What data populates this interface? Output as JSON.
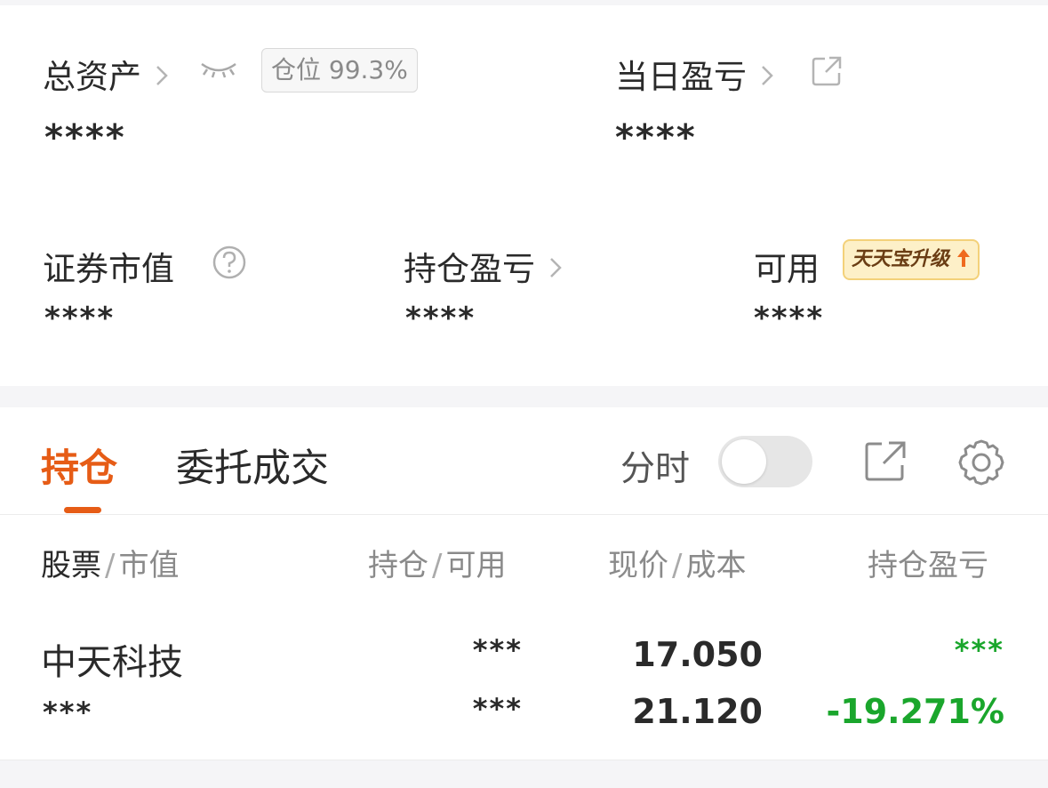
{
  "summary": {
    "total_assets_label": "总资产",
    "total_assets_value": "****",
    "position_ratio": "仓位 99.3%",
    "daily_pnl_label": "当日盈亏",
    "daily_pnl_value": "****",
    "securities_value_label": "证券市值",
    "securities_value_value": "****",
    "holding_pnl_label": "持仓盈亏",
    "holding_pnl_value": "****",
    "available_label": "可用",
    "available_value": "****",
    "upgrade_badge": "天天宝升级",
    "chevron": ">"
  },
  "tabs": [
    {
      "label": "持仓",
      "active": true
    },
    {
      "label": "委托成交",
      "active": false
    }
  ],
  "toolbar": {
    "timeshare_label": "分时",
    "timeshare_on": false
  },
  "table": {
    "columns": [
      {
        "main": "股票",
        "sub": "市值"
      },
      {
        "main": "持仓",
        "sub": "可用"
      },
      {
        "main": "现价",
        "sub": "成本"
      },
      {
        "main": "持仓盈亏",
        "sub": ""
      }
    ],
    "separator": "/",
    "rows": [
      {
        "name": "中天科技",
        "market_value": "***",
        "position": "***",
        "available": "***",
        "price": "17.050",
        "cost": "21.120",
        "pnl": "***",
        "pnl_pct": "-19.271%"
      }
    ]
  },
  "colors": {
    "accent": "#e65c16",
    "loss_green": "#1aa62c",
    "badge_bg": "#fdf0c8"
  },
  "icons": [
    "chevron-right-icon",
    "eye-closed-icon",
    "external-link-icon",
    "question-circle-icon",
    "up-arrow-icon",
    "share-icon",
    "gear-icon"
  ]
}
